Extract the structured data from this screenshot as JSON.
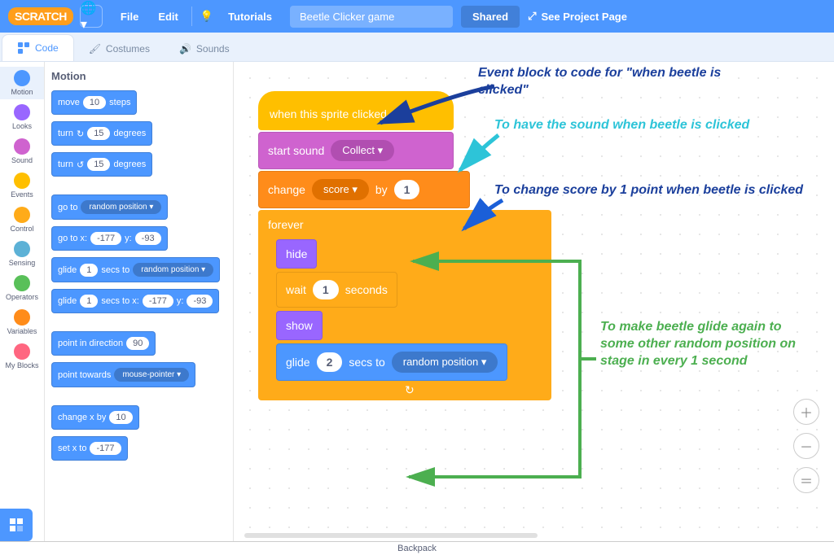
{
  "menubar": {
    "file": "File",
    "edit": "Edit",
    "tutorials": "Tutorials",
    "project_title": "Beetle Clicker game",
    "shared": "Shared",
    "see_page": "See Project Page"
  },
  "tabs": {
    "code": "Code",
    "costumes": "Costumes",
    "sounds": "Sounds"
  },
  "categories": [
    {
      "name": "Motion",
      "color": "#4c97ff"
    },
    {
      "name": "Looks",
      "color": "#9966ff"
    },
    {
      "name": "Sound",
      "color": "#cf63cf"
    },
    {
      "name": "Events",
      "color": "#ffbf00"
    },
    {
      "name": "Control",
      "color": "#ffab19"
    },
    {
      "name": "Sensing",
      "color": "#5cb1d6"
    },
    {
      "name": "Operators",
      "color": "#59c059"
    },
    {
      "name": "Variables",
      "color": "#ff8c1a"
    },
    {
      "name": "My Blocks",
      "color": "#ff6680"
    }
  ],
  "palette": {
    "header": "Motion",
    "move_steps": {
      "label1": "move",
      "val": "10",
      "label2": "steps"
    },
    "turn_cw": {
      "label1": "turn",
      "icon": "↻",
      "val": "15",
      "label2": "degrees"
    },
    "turn_ccw": {
      "label1": "turn",
      "icon": "↺",
      "val": "15",
      "label2": "degrees"
    },
    "goto": {
      "label": "go to",
      "dd": "random position ▾"
    },
    "goto_xy": {
      "label1": "go to x:",
      "x": "-177",
      "label2": "y:",
      "y": "-93"
    },
    "glide_to": {
      "label1": "glide",
      "secs": "1",
      "label2": "secs to",
      "dd": "random position ▾"
    },
    "glide_xy": {
      "label1": "glide",
      "secs": "1",
      "label2": "secs to x:",
      "x": "-177",
      "label3": "y:",
      "y": "-93"
    },
    "point_dir": {
      "label": "point in direction",
      "val": "90"
    },
    "point_towards": {
      "label": "point towards",
      "dd": "mouse-pointer ▾"
    },
    "change_x": {
      "label": "change x by",
      "val": "10"
    },
    "set_x": {
      "label": "set x to",
      "val": "-177"
    }
  },
  "script": {
    "hat": "when this sprite clicked",
    "start_sound": {
      "label": "start sound",
      "dd": "Collect ▾"
    },
    "change_var": {
      "label1": "change",
      "dd": "score ▾",
      "label2": "by",
      "val": "1"
    },
    "forever": "forever",
    "hide": "hide",
    "wait": {
      "label1": "wait",
      "val": "1",
      "label2": "seconds"
    },
    "show": "show",
    "glide": {
      "label1": "glide",
      "val": "2",
      "label2": "secs to",
      "dd": "random position ▾"
    }
  },
  "annotations": {
    "a1": "Event block to code for \"when beetle is clicked\"",
    "a2": "To have the sound when beetle is clicked",
    "a3": "To change score by 1 point when beetle is clicked",
    "a4": "To make beetle glide again to some other random position on stage in every 1 second"
  },
  "backpack": "Backpack",
  "logo": "SCRATCH"
}
